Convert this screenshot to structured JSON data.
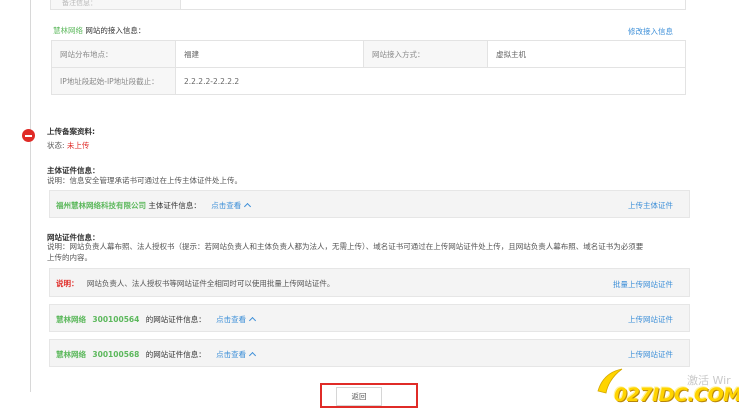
{
  "top_stub": {
    "label": "备注信息："
  },
  "access": {
    "site_name": "慧林网络",
    "title_suffix": "网站的接入信息：",
    "edit_link": "修改接入信息",
    "rows": [
      {
        "label1": "网站分布地点：",
        "value1": "福建",
        "label2": "网站接入方式：",
        "value2": "虚拟主机"
      },
      {
        "label1": "IP地址段起始-IP地址段截止：",
        "value1": "2.2.2.2-2.2.2.2"
      }
    ]
  },
  "upload": {
    "title": "上传备案资料:",
    "status_label": "状态:",
    "status_value": "未上传"
  },
  "subject_cert": {
    "title": "主体证件信息：",
    "note": "说明：信息安全管理承诺书可通过在上传主体证件处上传。",
    "company": "福州慧林网络科技有限公司",
    "info_label": "主体证件信息：",
    "toggle": "点击查看",
    "action": "上传主体证件"
  },
  "site_cert": {
    "title": "网站证件信息：",
    "note_line1": "说明：网站负责人幕布照、法人授权书（提示：若网站负责人和主体负责人都为法人，无需上传）、域名证书可通过在上传网站证件处上传，且网站负责人幕布照、域名证书为必须要",
    "note_line2": "上传的内容。",
    "tip_label": "说明：",
    "tip_text": "网站负责人、法人授权书等网站证件全相同时可以使用批量上传网站证件。",
    "batch_action": "批量上传网站证件",
    "items": [
      {
        "name": "慧林网络",
        "id": "300100564",
        "info_label": "的网站证件信息：",
        "toggle": "点击查看",
        "action": "上传网站证件"
      },
      {
        "name": "慧林网络",
        "id": "300100568",
        "info_label": "的网站证件信息：",
        "toggle": "点击查看",
        "action": "上传网站证件"
      }
    ]
  },
  "footer": {
    "back_button": "返回",
    "watermark": "激活 Wir",
    "logo_text": "027IDC.COM"
  },
  "colors": {
    "green": "#5cb85c",
    "link_blue": "#3d8fd8",
    "alert_red": "#e02b27",
    "logo_yellow": "#ffd400"
  }
}
